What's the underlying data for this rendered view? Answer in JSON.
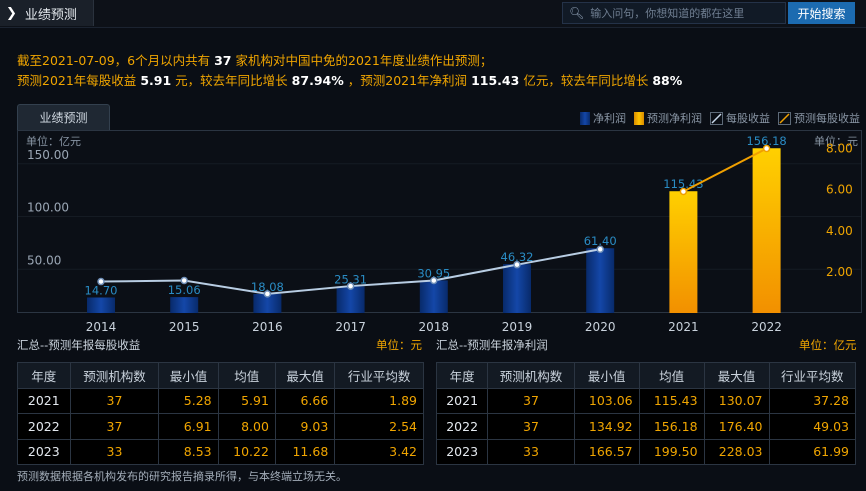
{
  "header": {
    "title": "业绩预测",
    "search_placeholder": "输入问句，你想知道的都在这里",
    "search_button": "开始搜索"
  },
  "summary": {
    "line1": {
      "pre": "截至2021-07-09，6个月以内共有",
      "count": "37",
      "post": "家机构对中国中免的2021年度业绩作出预测；"
    },
    "line2": {
      "a": "预测2021年每股收益",
      "eps": "5.91",
      "b": "元，较去年同比增长",
      "eps_growth": "87.94%",
      "c": "，预测2021年净利润",
      "profit": "115.43",
      "d": "亿元，较去年同比增长",
      "profit_growth": "88%"
    }
  },
  "tab": "业绩预测",
  "legend": [
    {
      "label": "净利润",
      "color": "#0d3a8a"
    },
    {
      "label": "预测净利润",
      "color": "#f0a000"
    },
    {
      "label": "每股收益",
      "color": "#c8d8ea"
    },
    {
      "label": "预测每股收益",
      "color": "#f0a000"
    }
  ],
  "chart_data": {
    "type": "bar",
    "left_unit": "单位：亿元",
    "right_unit": "单位：元",
    "categories": [
      "2014",
      "2015",
      "2016",
      "2017",
      "2018",
      "2019",
      "2020",
      "2021",
      "2022"
    ],
    "series": [
      {
        "name": "净利润",
        "values": [
          14.7,
          15.06,
          18.08,
          25.31,
          30.95,
          46.32,
          61.4,
          115.43,
          156.18
        ],
        "labels": [
          "14.70",
          "15.06",
          "18.08",
          "25.31",
          "30.95",
          "46.32",
          "61.40",
          "115.43",
          "156.18"
        ],
        "forecast_from": "2021"
      },
      {
        "name": "每股收益",
        "type": "line",
        "axis": "right",
        "values": [
          1.53,
          1.58,
          0.93,
          1.31,
          1.58,
          2.35,
          3.1,
          5.91,
          8.0
        ]
      }
    ],
    "left_ticks": [
      "50.00",
      "100.00",
      "150.00"
    ],
    "left_ylim": [
      0,
      170
    ],
    "right_ticks": [
      "2.00",
      "4.00",
      "6.00",
      "8.00"
    ],
    "right_ylim": [
      0,
      8.9
    ],
    "colors": {
      "bar": "#0d3a8a",
      "forecast_bar": "#f5b800",
      "line": "#b8cde3",
      "forecast_line": "#f0a000",
      "label": "#2a8cc4"
    }
  },
  "eps_table": {
    "title": "汇总--预测年报每股收益",
    "unit": "单位：元",
    "headers": [
      "年度",
      "预测机构数",
      "最小值",
      "均值",
      "最大值",
      "行业平均数"
    ],
    "rows": [
      [
        "2021",
        "37",
        "5.28",
        "5.91",
        "6.66",
        "1.89"
      ],
      [
        "2022",
        "37",
        "6.91",
        "8.00",
        "9.03",
        "2.54"
      ],
      [
        "2023",
        "33",
        "8.53",
        "10.22",
        "11.68",
        "3.42"
      ]
    ]
  },
  "profit_table": {
    "title": "汇总--预测年报净利润",
    "unit": "单位：亿元",
    "headers": [
      "年度",
      "预测机构数",
      "最小值",
      "均值",
      "最大值",
      "行业平均数"
    ],
    "rows": [
      [
        "2021",
        "37",
        "103.06",
        "115.43",
        "130.07",
        "37.28"
      ],
      [
        "2022",
        "37",
        "134.92",
        "156.18",
        "176.40",
        "49.03"
      ],
      [
        "2023",
        "33",
        "166.57",
        "199.50",
        "228.03",
        "61.99"
      ]
    ]
  },
  "footer": "预测数据根据各机构发布的研究报告摘录所得，与本终端立场无关。"
}
